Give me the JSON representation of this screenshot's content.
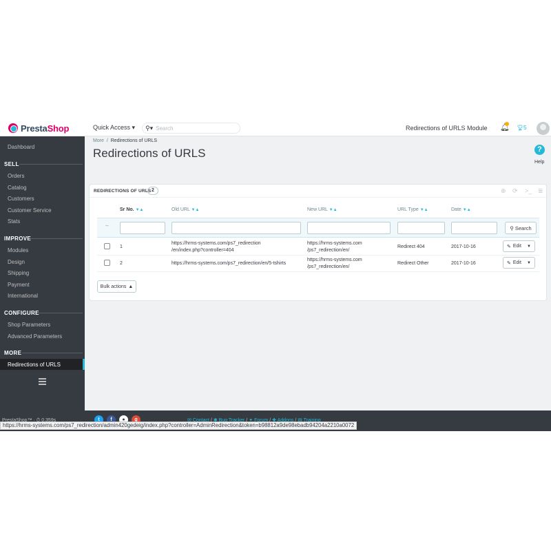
{
  "header": {
    "logo_text_a": "Presta",
    "logo_text_b": "Shop",
    "quick_access": "Quick Access ▾",
    "search_placeholder": "Search",
    "module_name": "Redirections of URLS Module",
    "notifications_count": "5"
  },
  "sidebar": {
    "dashboard": "Dashboard",
    "sections": [
      {
        "title": "SELL",
        "items": [
          "Orders",
          "Catalog",
          "Customers",
          "Customer Service",
          "Stats"
        ]
      },
      {
        "title": "IMPROVE",
        "items": [
          "Modules",
          "Design",
          "Shipping",
          "Payment",
          "International"
        ]
      },
      {
        "title": "CONFIGURE",
        "items": [
          "Shop Parameters",
          "Advanced Parameters"
        ]
      },
      {
        "title": "MORE",
        "items": [
          "Redirections of URLS"
        ]
      }
    ]
  },
  "breadcrumb": {
    "root": "More",
    "sep": "/",
    "current": "Redirections of URLS"
  },
  "page_title": "Redirections of URLS",
  "help_label": "Help",
  "panel": {
    "title": "REDIRECTIONS OF URLS",
    "count": "2",
    "columns": [
      "Sr No.",
      "Old URL",
      "New URL",
      "URL Type",
      "Date"
    ],
    "filter_placeholder": "--",
    "search_button": "Search",
    "rows": [
      {
        "sr": "1",
        "old_url_1": "https://hrms-systems.com/ps7_redirection",
        "old_url_2": "/en/index.php?controller=404",
        "new_url_1": "https://hrms-systems.com",
        "new_url_2": "/ps7_redirection/en/",
        "type": "Redirect 404",
        "date": "2017-10-16",
        "action": "Edit"
      },
      {
        "sr": "2",
        "old_url_1": "https://hrms-systems.com/ps7_redirection/en/5-tshirts",
        "old_url_2": "",
        "new_url_1": "https://hrms-systems.com",
        "new_url_2": "/ps7_redirection/en/",
        "type": "Redirect Other",
        "date": "2017-10-16",
        "action": "Edit"
      }
    ],
    "bulk_actions": "Bulk actions"
  },
  "footer": {
    "version": "PrestaShop™ · ⏱ 0.359s",
    "links": [
      "Contact",
      "Bug Tracker",
      "Forum",
      "Addons",
      "Training"
    ]
  },
  "status_url": "https://hrms-systems.com/ps7_redirection/admin420gedeig/index.php?controller=AdminRedirection&token=b98812a9de98ebadb94204a2210a0072",
  "colors": {
    "accent": "#25b9d7",
    "brand": "#df0067",
    "sidebar": "#363a41"
  }
}
